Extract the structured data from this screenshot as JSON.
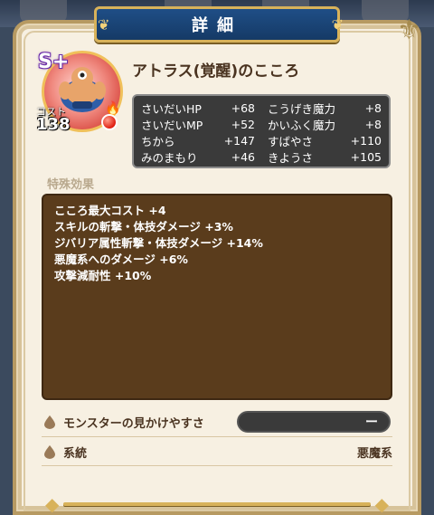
{
  "window": {
    "title": "詳細"
  },
  "heart": {
    "name": "アトラス(覚醒)のこころ",
    "rank": "S+",
    "cost_label": "コスト",
    "cost": "138"
  },
  "stats": [
    {
      "label": "さいだいHP",
      "value": "+68"
    },
    {
      "label": "こうげき魔力",
      "value": "+8"
    },
    {
      "label": "さいだいMP",
      "value": "+52"
    },
    {
      "label": "かいふく魔力",
      "value": "+8"
    },
    {
      "label": "ちから",
      "value": "+147"
    },
    {
      "label": "すばやさ",
      "value": "+110"
    },
    {
      "label": "みのまもり",
      "value": "+46"
    },
    {
      "label": "きようさ",
      "value": "+105"
    }
  ],
  "special": {
    "title": "特殊効果",
    "effects": [
      "こころ最大コスト +4",
      "スキルの斬撃・体技ダメージ +3%",
      "ジバリア属性斬撃・体技ダメージ +14%",
      "悪魔系へのダメージ +6%",
      "攻撃減耐性 +10%"
    ]
  },
  "info": {
    "visibility_label": "モンスターの見かけやすさ",
    "visibility_value": "ー",
    "family_label": "系統",
    "family_value": "悪魔系"
  },
  "colors": {
    "title_bar": "#1f4e86",
    "gold": "#d8b25a",
    "panel": "#f7f0e2",
    "special_box": "#5a3c1c",
    "stats_box": "#3a3a3a"
  },
  "icons": [
    "droplet-icon",
    "star-icon",
    "flame-icon"
  ]
}
